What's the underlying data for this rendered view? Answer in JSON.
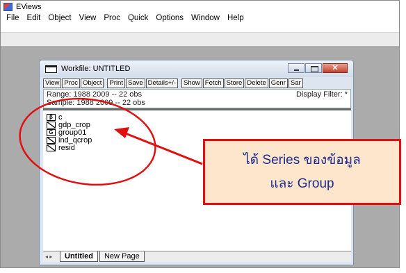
{
  "app": {
    "title": "EViews",
    "icon": "eviews-app-icon",
    "menu": [
      "File",
      "Edit",
      "Object",
      "View",
      "Proc",
      "Quick",
      "Options",
      "Window",
      "Help"
    ]
  },
  "workfile": {
    "title": "Workfile: UNTITLED",
    "toolbar": [
      "View",
      "Proc",
      "Object",
      "Print",
      "Save",
      "Details+/-",
      "Show",
      "Fetch",
      "Store",
      "Delete",
      "Genr",
      "Sar"
    ],
    "range": "Range:  1988 2009  --  22 obs",
    "sample": "Sample: 1988 2009  --  22 obs",
    "display_filter": "Display Filter: *",
    "objects": [
      {
        "icon": "coef-icon",
        "badge": "β",
        "name": "c"
      },
      {
        "icon": "series-icon",
        "badge": "",
        "name": "gdp_crop"
      },
      {
        "icon": "group-icon",
        "badge": "G",
        "name": "group01"
      },
      {
        "icon": "series-icon",
        "badge": "",
        "name": "ind_qcrop"
      },
      {
        "icon": "series-icon",
        "badge": "",
        "name": "resid"
      }
    ],
    "tabs": {
      "nav": "◂ ▸",
      "active": "Untitled",
      "inactive": "New Page"
    }
  },
  "annotation": {
    "line1": "ได้ Series ของข้อมูล",
    "line2": "และ Group",
    "color": "#e01010"
  }
}
